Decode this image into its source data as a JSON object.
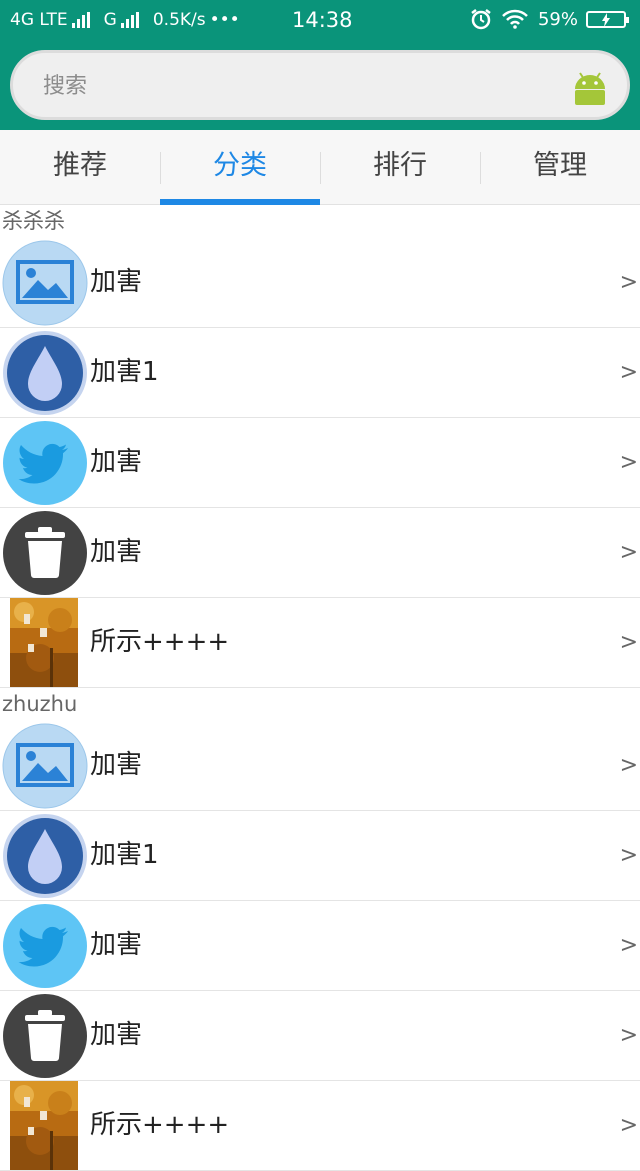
{
  "status_bar": {
    "network_1": "4G LTE",
    "network_2": "G",
    "speed": "0.5K/s",
    "more": "•••",
    "time": "14:38",
    "battery": "59%"
  },
  "search": {
    "placeholder": "搜索"
  },
  "tabs": [
    {
      "label": "推荐",
      "active": false
    },
    {
      "label": "分类",
      "active": true
    },
    {
      "label": "排行",
      "active": false
    },
    {
      "label": "管理",
      "active": false
    }
  ],
  "colors": {
    "header": "#0a947a",
    "accent": "#1e88e5"
  },
  "groups": [
    {
      "title": "杀杀杀",
      "items": [
        {
          "label": "加害",
          "icon": "image-icon",
          "arrow": ">"
        },
        {
          "label": "加害1",
          "icon": "water-drop-icon",
          "arrow": ">"
        },
        {
          "label": "加害",
          "icon": "twitter-bird-icon",
          "arrow": ">"
        },
        {
          "label": "加害",
          "icon": "trash-icon",
          "arrow": ">"
        },
        {
          "label": "所示++++",
          "icon": "autumn-photo-icon",
          "arrow": ">"
        }
      ]
    },
    {
      "title": "zhuzhu",
      "items": [
        {
          "label": "加害",
          "icon": "image-icon",
          "arrow": ">"
        },
        {
          "label": "加害1",
          "icon": "water-drop-icon",
          "arrow": ">"
        },
        {
          "label": "加害",
          "icon": "twitter-bird-icon",
          "arrow": ">"
        },
        {
          "label": "加害",
          "icon": "trash-icon",
          "arrow": ">"
        },
        {
          "label": "所示++++",
          "icon": "autumn-photo-icon",
          "arrow": ">"
        }
      ]
    }
  ]
}
